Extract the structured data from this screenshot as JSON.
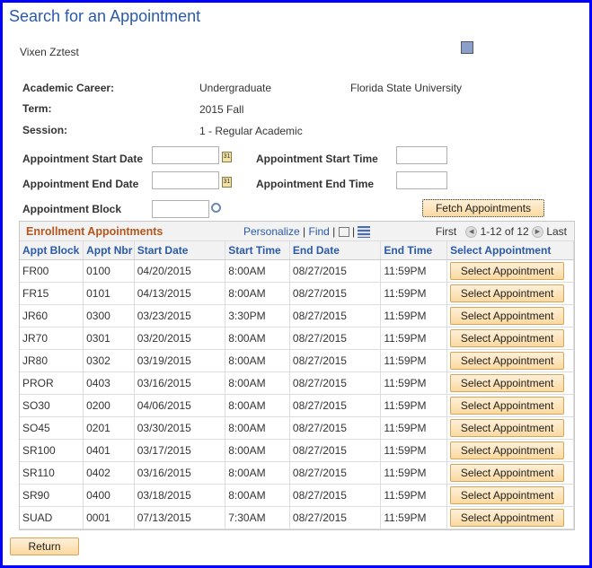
{
  "page": {
    "title": "Search for an Appointment",
    "student": "Vixen Zztest"
  },
  "info": {
    "career_label": "Academic Career:",
    "career": "Undergraduate",
    "institution": "Florida State University",
    "term_label": "Term:",
    "term": "2015 Fall",
    "session_label": "Session:",
    "session": "1 - Regular Academic"
  },
  "search": {
    "start_date_label": "Appointment Start Date",
    "end_date_label": "Appointment End Date",
    "block_label": "Appointment Block",
    "start_time_label": "Appointment Start Time",
    "end_time_label": "Appointment End Time",
    "start_date": "",
    "end_date": "",
    "block": "",
    "start_time": "",
    "end_time": "",
    "fetch_label": "Fetch Appointments"
  },
  "grid": {
    "title": "Enrollment Appointments",
    "personalize": "Personalize",
    "find": "Find",
    "first": "First",
    "range": "1-12 of 12",
    "last": "Last",
    "columns": [
      "Appt Block",
      "Appt Nbr",
      "Start Date",
      "Start Time",
      "End Date",
      "End Time",
      "Select Appointment"
    ],
    "select_label": "Select Appointment",
    "rows": [
      [
        "FR00",
        "0100",
        "04/20/2015",
        "8:00AM",
        "08/27/2015",
        "11:59PM"
      ],
      [
        "FR15",
        "0101",
        "04/13/2015",
        "8:00AM",
        "08/27/2015",
        "11:59PM"
      ],
      [
        "JR60",
        "0300",
        "03/23/2015",
        "3:30PM",
        "08/27/2015",
        "11:59PM"
      ],
      [
        "JR70",
        "0301",
        "03/20/2015",
        "8:00AM",
        "08/27/2015",
        "11:59PM"
      ],
      [
        "JR80",
        "0302",
        "03/19/2015",
        "8:00AM",
        "08/27/2015",
        "11:59PM"
      ],
      [
        "PROR",
        "0403",
        "03/16/2015",
        "8:00AM",
        "08/27/2015",
        "11:59PM"
      ],
      [
        "SO30",
        "0200",
        "04/06/2015",
        "8:00AM",
        "08/27/2015",
        "11:59PM"
      ],
      [
        "SO45",
        "0201",
        "03/30/2015",
        "8:00AM",
        "08/27/2015",
        "11:59PM"
      ],
      [
        "SR100",
        "0401",
        "03/17/2015",
        "8:00AM",
        "08/27/2015",
        "11:59PM"
      ],
      [
        "SR110",
        "0402",
        "03/16/2015",
        "8:00AM",
        "08/27/2015",
        "11:59PM"
      ],
      [
        "SR90",
        "0400",
        "03/18/2015",
        "8:00AM",
        "08/27/2015",
        "11:59PM"
      ],
      [
        "SUAD",
        "0001",
        "07/13/2015",
        "7:30AM",
        "08/27/2015",
        "11:59PM"
      ]
    ]
  },
  "footer": {
    "return_label": "Return"
  }
}
